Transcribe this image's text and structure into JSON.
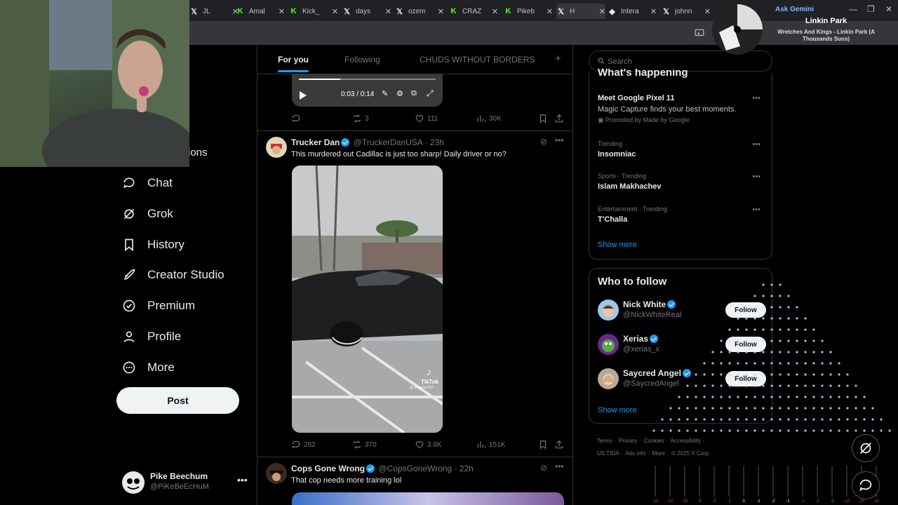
{
  "browser": {
    "tabs": [
      {
        "label": "JL",
        "favicon": "x-logo-icon"
      },
      {
        "label": "Amal",
        "favicon": "kick-icon"
      },
      {
        "label": "Kick_",
        "favicon": "kick-icon"
      },
      {
        "label": "days",
        "favicon": "x-logo-icon"
      },
      {
        "label": "ozem",
        "favicon": "x-logo-icon"
      },
      {
        "label": "CRAZ",
        "favicon": "kick-icon"
      },
      {
        "label": "Pikeb",
        "favicon": "kick-icon"
      },
      {
        "label": "H",
        "favicon": "x-logo-icon"
      },
      {
        "label": "Intera",
        "favicon": "gem-icon"
      },
      {
        "label": "johnn",
        "favicon": "x-logo-icon"
      }
    ],
    "ask_gemini": "Ask Gemini"
  },
  "now_playing": {
    "artist": "Linkin Park",
    "track": "Wretches And Kings - Linkin Park (A Thousands Suns)"
  },
  "nav": {
    "partial_item": "ions",
    "items": [
      {
        "label": "Chat",
        "icon": "chat-icon"
      },
      {
        "label": "Grok",
        "icon": "grok-icon"
      },
      {
        "label": "History",
        "icon": "bookmark-icon"
      },
      {
        "label": "Creator Studio",
        "icon": "rocket-icon"
      },
      {
        "label": "Premium",
        "icon": "premium-icon"
      },
      {
        "label": "Profile",
        "icon": "person-icon"
      },
      {
        "label": "More",
        "icon": "more-circle-icon"
      }
    ],
    "post_label": "Post"
  },
  "account": {
    "name": "Pike Beechum",
    "handle": "@PiKeBeEcHuM"
  },
  "feed": {
    "tabs": [
      "For you",
      "Following",
      "CHUDS WITHOUT BORDERS"
    ],
    "active_tab": "For you",
    "prev_tweet": {
      "video_time": "0:03 / 0:14",
      "retweets": "3",
      "likes": "111",
      "views": "30K"
    },
    "tweets": [
      {
        "name": "Trucker Dan",
        "handle": "@TruckerDanUSA",
        "time": "· 23h",
        "text": "This murdered out Cadillac is just too sharp! Daily driver or no?",
        "media_watermark": "TikTok",
        "media_user": "@ redram3707",
        "replies": "282",
        "retweets": "370",
        "likes": "3.8K",
        "views": "151K"
      },
      {
        "name": "Cops Gone Wrong",
        "handle": "@CopsGoneWrong",
        "time": "· 22h",
        "text": "That cop needs more training lol"
      }
    ]
  },
  "right": {
    "search_placeholder": "Search",
    "happening_title": "What's happening",
    "trends": [
      {
        "meta": "Promoted by Made by Google",
        "title": "Meet Google Pixel 11",
        "desc": "Magic Capture finds your best moments."
      },
      {
        "meta": "Trending",
        "title": "Insomniac"
      },
      {
        "meta": "Sports · Trending",
        "title": "Islam Makhachev"
      },
      {
        "meta": "Entertainment · Trending",
        "title": "T'Challa"
      }
    ],
    "show_more": "Show more",
    "who_to_follow_title": "Who to follow",
    "follow": [
      {
        "name": "Nick White",
        "handle": "@NickWhiteReal",
        "button": "Follow"
      },
      {
        "name": "Xerias",
        "handle": "@xerias_x",
        "button": "Follow"
      },
      {
        "name": "Saycred Angel",
        "handle": "@SaycredAngel",
        "button": "Follow"
      }
    ],
    "show_more_2": "Show more",
    "footer": [
      "Terms",
      "Privacy",
      "Cookies",
      "Accessibility",
      "US TIDA",
      "Ads info",
      "More",
      "© 2025 X Corp."
    ]
  },
  "vu_labels": [
    "-10",
    "-20",
    "-10",
    "-5",
    "-2",
    "-1",
    "0",
    "-1",
    "-2",
    "-1",
    "-1",
    "-2",
    "-5",
    "-10",
    "-20",
    "-10"
  ],
  "colors": {
    "accent": "#1d9bf0",
    "border": "#2f3336",
    "muted": "#71767b",
    "text": "#e7e9ea"
  }
}
